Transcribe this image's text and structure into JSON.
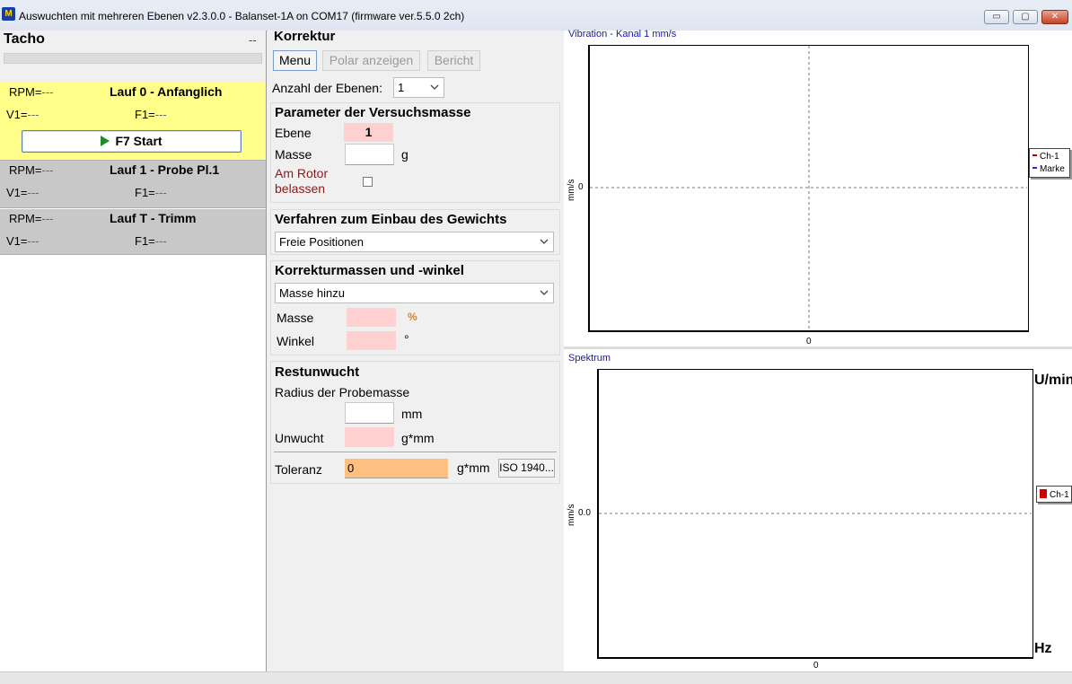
{
  "window": {
    "title": "Auswuchten mit mehreren Ebenen v2.3.0.0 - Balanset-1A on COM17 (firmware ver.5.5.0 2ch)",
    "icon_text": "M",
    "minimize": "▭",
    "maximize": "▢",
    "close": "✕"
  },
  "tacho": {
    "label": "Tacho",
    "value": "--"
  },
  "runs": [
    {
      "rpm_label": "RPM=",
      "rpm_value": "---",
      "name": "Lauf 0 - Anfanglich",
      "v1_label": "V1=",
      "v1_value": "---",
      "f1_label": "F1=",
      "f1_value": "---"
    },
    {
      "rpm_label": "RPM=",
      "rpm_value": "---",
      "name": "Lauf 1 - Probe Pl.1",
      "v1_label": "V1=",
      "v1_value": "---",
      "f1_label": "F1=",
      "f1_value": "---"
    },
    {
      "rpm_label": "RPM=",
      "rpm_value": "---",
      "name": "Lauf T - Trimm",
      "v1_label": "V1=",
      "v1_value": "---",
      "f1_label": "F1=",
      "f1_value": "---"
    }
  ],
  "start_button": "F7 Start",
  "korrektur": {
    "title": "Korrektur",
    "menu": "Menu",
    "polar": "Polar anzeigen",
    "bericht": "Bericht",
    "planes_label": "Anzahl der Ebenen:",
    "planes_value": "1"
  },
  "trial": {
    "title": "Parameter der Versuchsmasse",
    "plane_label": "Ebene",
    "plane_value": "1",
    "mass_label": "Masse",
    "mass_unit": "g",
    "leave_line1": "Am Rotor",
    "leave_line2": "belassen"
  },
  "install": {
    "title": "Verfahren zum Einbau des Gewichts",
    "method": "Freie Positionen"
  },
  "correction": {
    "title": "Korrekturmassen und -winkel",
    "mode": "Masse hinzu",
    "mass_label": "Masse",
    "mass_unit": "%",
    "angle_label": "Winkel",
    "angle_unit": "°"
  },
  "residual": {
    "title": "Restunwucht",
    "radius_label": "Radius der Probemasse",
    "radius_unit": "mm",
    "unbalance_label": "Unwucht",
    "unbalance_unit": "g*mm",
    "tolerance_label": "Toleranz",
    "tolerance_value": "0",
    "tolerance_unit": "g*mm",
    "iso_button": "ISO 1940..."
  },
  "vib_chart": {
    "title": "Vibration - Kanal 1 mm/s",
    "ylabel": "mm/s",
    "y_tick": "0",
    "x_tick": "0",
    "legend": [
      "Ch-1",
      "Marke"
    ],
    "colors": {
      "ch1": "#b00000",
      "marke": "#2a2ad0"
    }
  },
  "spec_chart": {
    "title": "Spektrum",
    "ylabel": "mm/s",
    "y_tick": "0.0",
    "x_tick": "0",
    "unit_top": "U/min",
    "unit_bottom": "Hz",
    "legend": [
      "Ch-1"
    ],
    "colors": {
      "ch1": "#cc0000"
    }
  },
  "colors": {
    "active_run": "#ffff8a",
    "run_bg": "#c8c8c8",
    "warn_text": "#8b1a1a",
    "tolerance_bg": "#ffc080",
    "percent_unit": "#e08020"
  }
}
